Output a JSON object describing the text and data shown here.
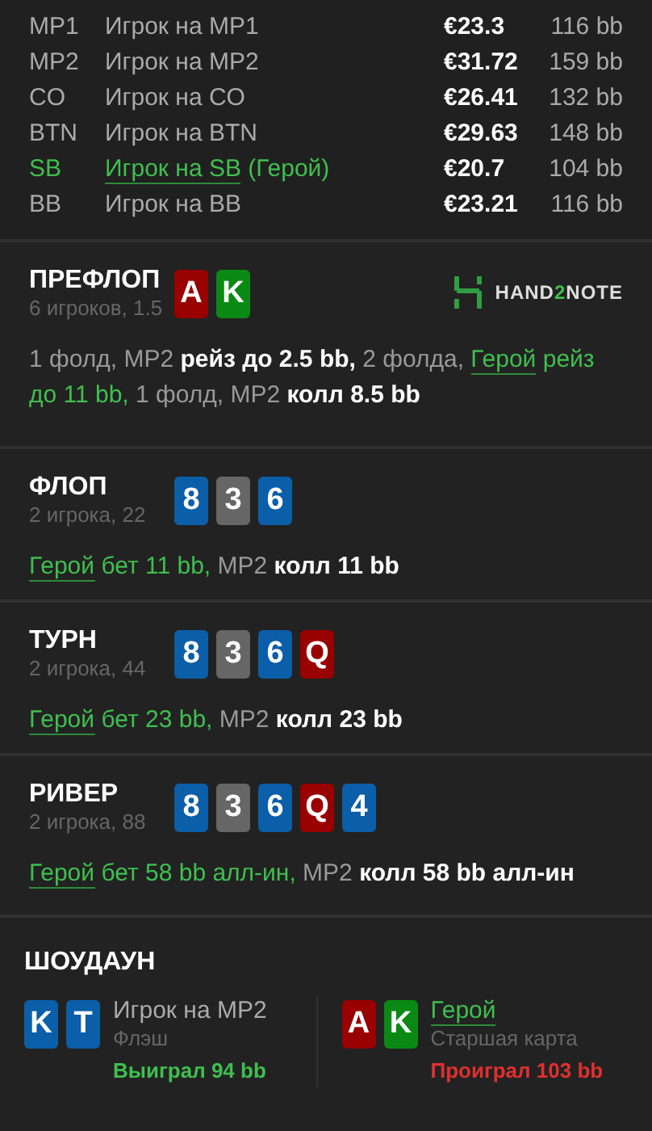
{
  "players": [
    {
      "position": "MP1",
      "name": "Игрок на MP1",
      "hero": false,
      "stack": "€23.3",
      "bb": "116 bb"
    },
    {
      "position": "MP2",
      "name": "Игрок на MP2",
      "hero": false,
      "stack": "€31.72",
      "bb": "159 bb"
    },
    {
      "position": "CO",
      "name": "Игрок на CO",
      "hero": false,
      "stack": "€26.41",
      "bb": "132 bb"
    },
    {
      "position": "BTN",
      "name": "Игрок на BTN",
      "hero": false,
      "stack": "€29.63",
      "bb": "148 bb"
    },
    {
      "position": "SB",
      "name": "Игрок на SB",
      "hero": true,
      "hero_tag": "(Герой)",
      "stack": "€20.7",
      "bb": "104 bb"
    },
    {
      "position": "BB",
      "name": "Игрок на BB",
      "hero": false,
      "stack": "€23.21",
      "bb": "116 bb"
    }
  ],
  "streets": [
    {
      "title": "ПРЕФЛОП",
      "info": "6 игроков, 1.5",
      "logo": {
        "before": "HAND",
        "accent": "2",
        "after": "NOTE"
      },
      "cards": [
        {
          "rank": "A",
          "color": "#990000"
        },
        {
          "rank": "K",
          "color": "#0a8a14"
        }
      ],
      "actions": [
        {
          "kind": "muted",
          "text": "1 фолд, MP2 "
        },
        {
          "kind": "bold",
          "text": "рейз до 2.5 bb,"
        },
        {
          "kind": "muted",
          "text": " 2 фолда, "
        },
        {
          "kind": "hero-link",
          "text": "Герой"
        },
        {
          "kind": "hero",
          "text": " рейз до 11 bb,"
        },
        {
          "kind": "muted",
          "text": " 1 фолд, MP2 "
        },
        {
          "kind": "bold",
          "text": "колл 8.5 bb"
        }
      ]
    },
    {
      "title": "ФЛОП",
      "info": "2 игрока, 22",
      "cards": [
        {
          "rank": "8",
          "color": "#0b5ea8"
        },
        {
          "rank": "3",
          "color": "#666666"
        },
        {
          "rank": "6",
          "color": "#0b5ea8"
        }
      ],
      "actions": [
        {
          "kind": "hero-link",
          "text": "Герой"
        },
        {
          "kind": "hero",
          "text": " бет 11 bb,"
        },
        {
          "kind": "muted",
          "text": " MP2 "
        },
        {
          "kind": "bold",
          "text": "колл 11 bb"
        }
      ]
    },
    {
      "title": "ТУРН",
      "info": "2 игрока, 44",
      "cards": [
        {
          "rank": "8",
          "color": "#0b5ea8"
        },
        {
          "rank": "3",
          "color": "#666666"
        },
        {
          "rank": "6",
          "color": "#0b5ea8"
        },
        {
          "rank": "Q",
          "color": "#990000"
        }
      ],
      "actions": [
        {
          "kind": "hero-link",
          "text": "Герой"
        },
        {
          "kind": "hero",
          "text": " бет 23 bb,"
        },
        {
          "kind": "muted",
          "text": " MP2 "
        },
        {
          "kind": "bold",
          "text": "колл 23 bb"
        }
      ]
    },
    {
      "title": "РИВЕР",
      "info": "2 игрока, 88",
      "cards": [
        {
          "rank": "8",
          "color": "#0b5ea8"
        },
        {
          "rank": "3",
          "color": "#666666"
        },
        {
          "rank": "6",
          "color": "#0b5ea8"
        },
        {
          "rank": "Q",
          "color": "#990000"
        },
        {
          "rank": "4",
          "color": "#0b5ea8"
        }
      ],
      "actions": [
        {
          "kind": "hero-link",
          "text": "Герой"
        },
        {
          "kind": "hero",
          "text": " бет 58 bb алл-ин,"
        },
        {
          "kind": "muted",
          "text": " MP2 "
        },
        {
          "kind": "bold",
          "text": "колл 58 bb алл-ин"
        }
      ]
    }
  ],
  "showdown": {
    "title": "ШОУДАУН",
    "hands": [
      {
        "cards": [
          {
            "rank": "K",
            "color": "#0b5ea8"
          },
          {
            "rank": "T",
            "color": "#0b5ea8"
          }
        ],
        "name": "Игрок на MP2",
        "hero": false,
        "hand": "Флэш",
        "result": "Выиграл 94 bb",
        "won": true
      },
      {
        "cards": [
          {
            "rank": "A",
            "color": "#990000"
          },
          {
            "rank": "K",
            "color": "#0a8a14"
          }
        ],
        "name": "Герой",
        "hero": true,
        "hand": "Старшая карта",
        "result": "Проиграл 103 bb",
        "won": false
      }
    ]
  }
}
